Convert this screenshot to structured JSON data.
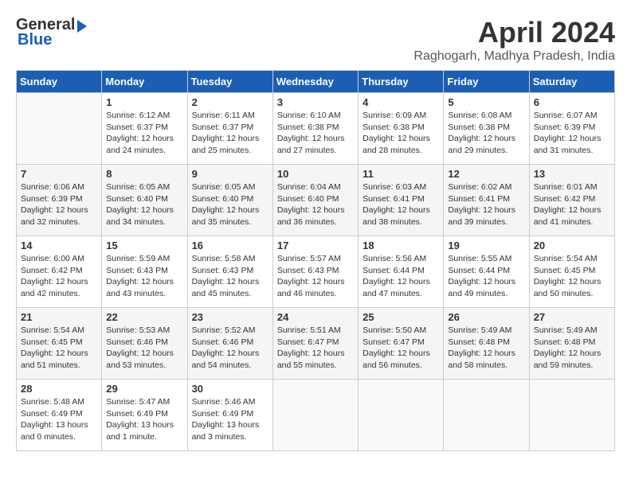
{
  "header": {
    "logo_general": "General",
    "logo_blue": "Blue",
    "month_title": "April 2024",
    "location": "Raghogarh, Madhya Pradesh, India"
  },
  "days_of_week": [
    "Sunday",
    "Monday",
    "Tuesday",
    "Wednesday",
    "Thursday",
    "Friday",
    "Saturday"
  ],
  "weeks": [
    [
      {
        "day": "",
        "info": ""
      },
      {
        "day": "1",
        "info": "Sunrise: 6:12 AM\nSunset: 6:37 PM\nDaylight: 12 hours\nand 24 minutes."
      },
      {
        "day": "2",
        "info": "Sunrise: 6:11 AM\nSunset: 6:37 PM\nDaylight: 12 hours\nand 25 minutes."
      },
      {
        "day": "3",
        "info": "Sunrise: 6:10 AM\nSunset: 6:38 PM\nDaylight: 12 hours\nand 27 minutes."
      },
      {
        "day": "4",
        "info": "Sunrise: 6:09 AM\nSunset: 6:38 PM\nDaylight: 12 hours\nand 28 minutes."
      },
      {
        "day": "5",
        "info": "Sunrise: 6:08 AM\nSunset: 6:38 PM\nDaylight: 12 hours\nand 29 minutes."
      },
      {
        "day": "6",
        "info": "Sunrise: 6:07 AM\nSunset: 6:39 PM\nDaylight: 12 hours\nand 31 minutes."
      }
    ],
    [
      {
        "day": "7",
        "info": "Sunrise: 6:06 AM\nSunset: 6:39 PM\nDaylight: 12 hours\nand 32 minutes."
      },
      {
        "day": "8",
        "info": "Sunrise: 6:05 AM\nSunset: 6:40 PM\nDaylight: 12 hours\nand 34 minutes."
      },
      {
        "day": "9",
        "info": "Sunrise: 6:05 AM\nSunset: 6:40 PM\nDaylight: 12 hours\nand 35 minutes."
      },
      {
        "day": "10",
        "info": "Sunrise: 6:04 AM\nSunset: 6:40 PM\nDaylight: 12 hours\nand 36 minutes."
      },
      {
        "day": "11",
        "info": "Sunrise: 6:03 AM\nSunset: 6:41 PM\nDaylight: 12 hours\nand 38 minutes."
      },
      {
        "day": "12",
        "info": "Sunrise: 6:02 AM\nSunset: 6:41 PM\nDaylight: 12 hours\nand 39 minutes."
      },
      {
        "day": "13",
        "info": "Sunrise: 6:01 AM\nSunset: 6:42 PM\nDaylight: 12 hours\nand 41 minutes."
      }
    ],
    [
      {
        "day": "14",
        "info": "Sunrise: 6:00 AM\nSunset: 6:42 PM\nDaylight: 12 hours\nand 42 minutes."
      },
      {
        "day": "15",
        "info": "Sunrise: 5:59 AM\nSunset: 6:43 PM\nDaylight: 12 hours\nand 43 minutes."
      },
      {
        "day": "16",
        "info": "Sunrise: 5:58 AM\nSunset: 6:43 PM\nDaylight: 12 hours\nand 45 minutes."
      },
      {
        "day": "17",
        "info": "Sunrise: 5:57 AM\nSunset: 6:43 PM\nDaylight: 12 hours\nand 46 minutes."
      },
      {
        "day": "18",
        "info": "Sunrise: 5:56 AM\nSunset: 6:44 PM\nDaylight: 12 hours\nand 47 minutes."
      },
      {
        "day": "19",
        "info": "Sunrise: 5:55 AM\nSunset: 6:44 PM\nDaylight: 12 hours\nand 49 minutes."
      },
      {
        "day": "20",
        "info": "Sunrise: 5:54 AM\nSunset: 6:45 PM\nDaylight: 12 hours\nand 50 minutes."
      }
    ],
    [
      {
        "day": "21",
        "info": "Sunrise: 5:54 AM\nSunset: 6:45 PM\nDaylight: 12 hours\nand 51 minutes."
      },
      {
        "day": "22",
        "info": "Sunrise: 5:53 AM\nSunset: 6:46 PM\nDaylight: 12 hours\nand 53 minutes."
      },
      {
        "day": "23",
        "info": "Sunrise: 5:52 AM\nSunset: 6:46 PM\nDaylight: 12 hours\nand 54 minutes."
      },
      {
        "day": "24",
        "info": "Sunrise: 5:51 AM\nSunset: 6:47 PM\nDaylight: 12 hours\nand 55 minutes."
      },
      {
        "day": "25",
        "info": "Sunrise: 5:50 AM\nSunset: 6:47 PM\nDaylight: 12 hours\nand 56 minutes."
      },
      {
        "day": "26",
        "info": "Sunrise: 5:49 AM\nSunset: 6:48 PM\nDaylight: 12 hours\nand 58 minutes."
      },
      {
        "day": "27",
        "info": "Sunrise: 5:49 AM\nSunset: 6:48 PM\nDaylight: 12 hours\nand 59 minutes."
      }
    ],
    [
      {
        "day": "28",
        "info": "Sunrise: 5:48 AM\nSunset: 6:49 PM\nDaylight: 13 hours\nand 0 minutes."
      },
      {
        "day": "29",
        "info": "Sunrise: 5:47 AM\nSunset: 6:49 PM\nDaylight: 13 hours\nand 1 minute."
      },
      {
        "day": "30",
        "info": "Sunrise: 5:46 AM\nSunset: 6:49 PM\nDaylight: 13 hours\nand 3 minutes."
      },
      {
        "day": "",
        "info": ""
      },
      {
        "day": "",
        "info": ""
      },
      {
        "day": "",
        "info": ""
      },
      {
        "day": "",
        "info": ""
      }
    ]
  ]
}
